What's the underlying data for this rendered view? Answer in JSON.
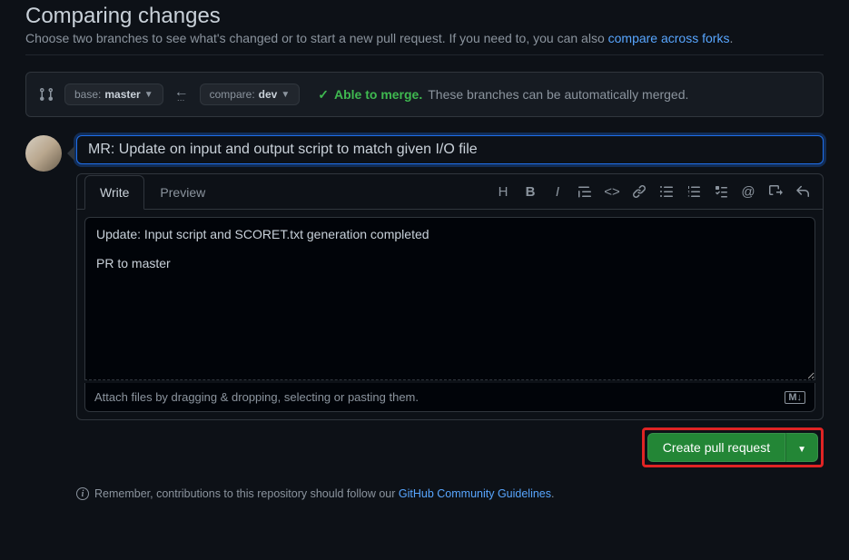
{
  "header": {
    "title": "Comparing changes",
    "subtitle_before": "Choose two branches to see what's changed or to start a new pull request. If you need to, you can also ",
    "subtitle_link": "compare across forks",
    "subtitle_after": "."
  },
  "branches": {
    "base_label": "base:",
    "base_name": "master",
    "compare_label": "compare:",
    "compare_name": "dev"
  },
  "merge": {
    "status_text": "Able to merge.",
    "detail_text": "These branches can be automatically merged."
  },
  "pr": {
    "title_value": "MR: Update on input and output script to match given I/O file",
    "body_value": "Update: Input script and SCORET.txt generation completed\n\nPR to master",
    "attach_hint": "Attach files by dragging & dropping, selecting or pasting them.",
    "md_badge": "M↓"
  },
  "tabs": {
    "write": "Write",
    "preview": "Preview"
  },
  "actions": {
    "create_pr": "Create pull request"
  },
  "footer": {
    "before": "Remember, contributions to this repository should follow our ",
    "link": "GitHub Community Guidelines",
    "after": "."
  }
}
